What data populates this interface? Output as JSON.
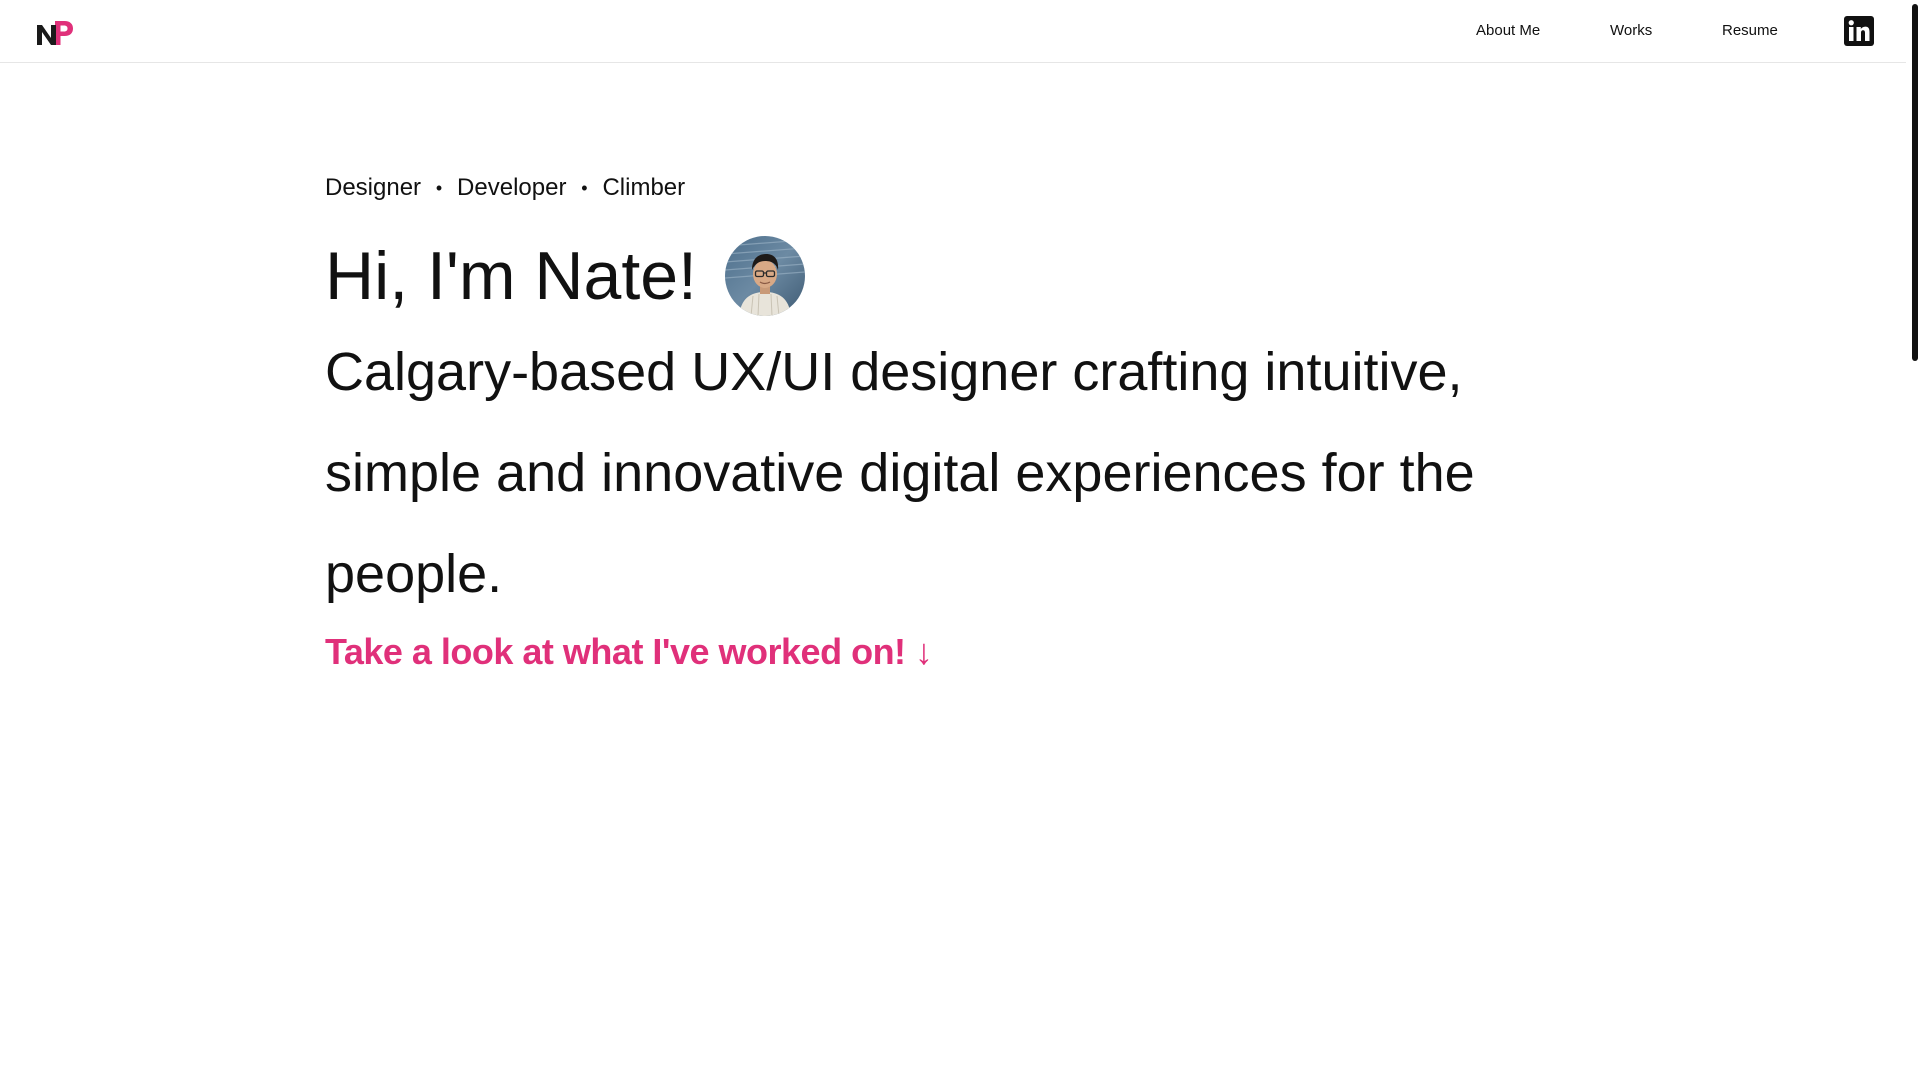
{
  "header": {
    "logo_letters": "NP",
    "nav": {
      "about": "About Me",
      "works": "Works",
      "resume": "Resume"
    },
    "social_icon": "linkedin-icon"
  },
  "hero": {
    "roles": [
      "Designer",
      "Developer",
      "Climber"
    ],
    "separator": "•",
    "greeting": "Hi, I'm Nate!",
    "tagline": "Calgary-based UX/UI designer crafting intuitive, simple and innovative digital experiences for the people.",
    "cta": "Take a look at what I've worked on! ↓"
  },
  "colors": {
    "accent": "#e0307a",
    "text": "#111111",
    "background": "#ffffff"
  }
}
